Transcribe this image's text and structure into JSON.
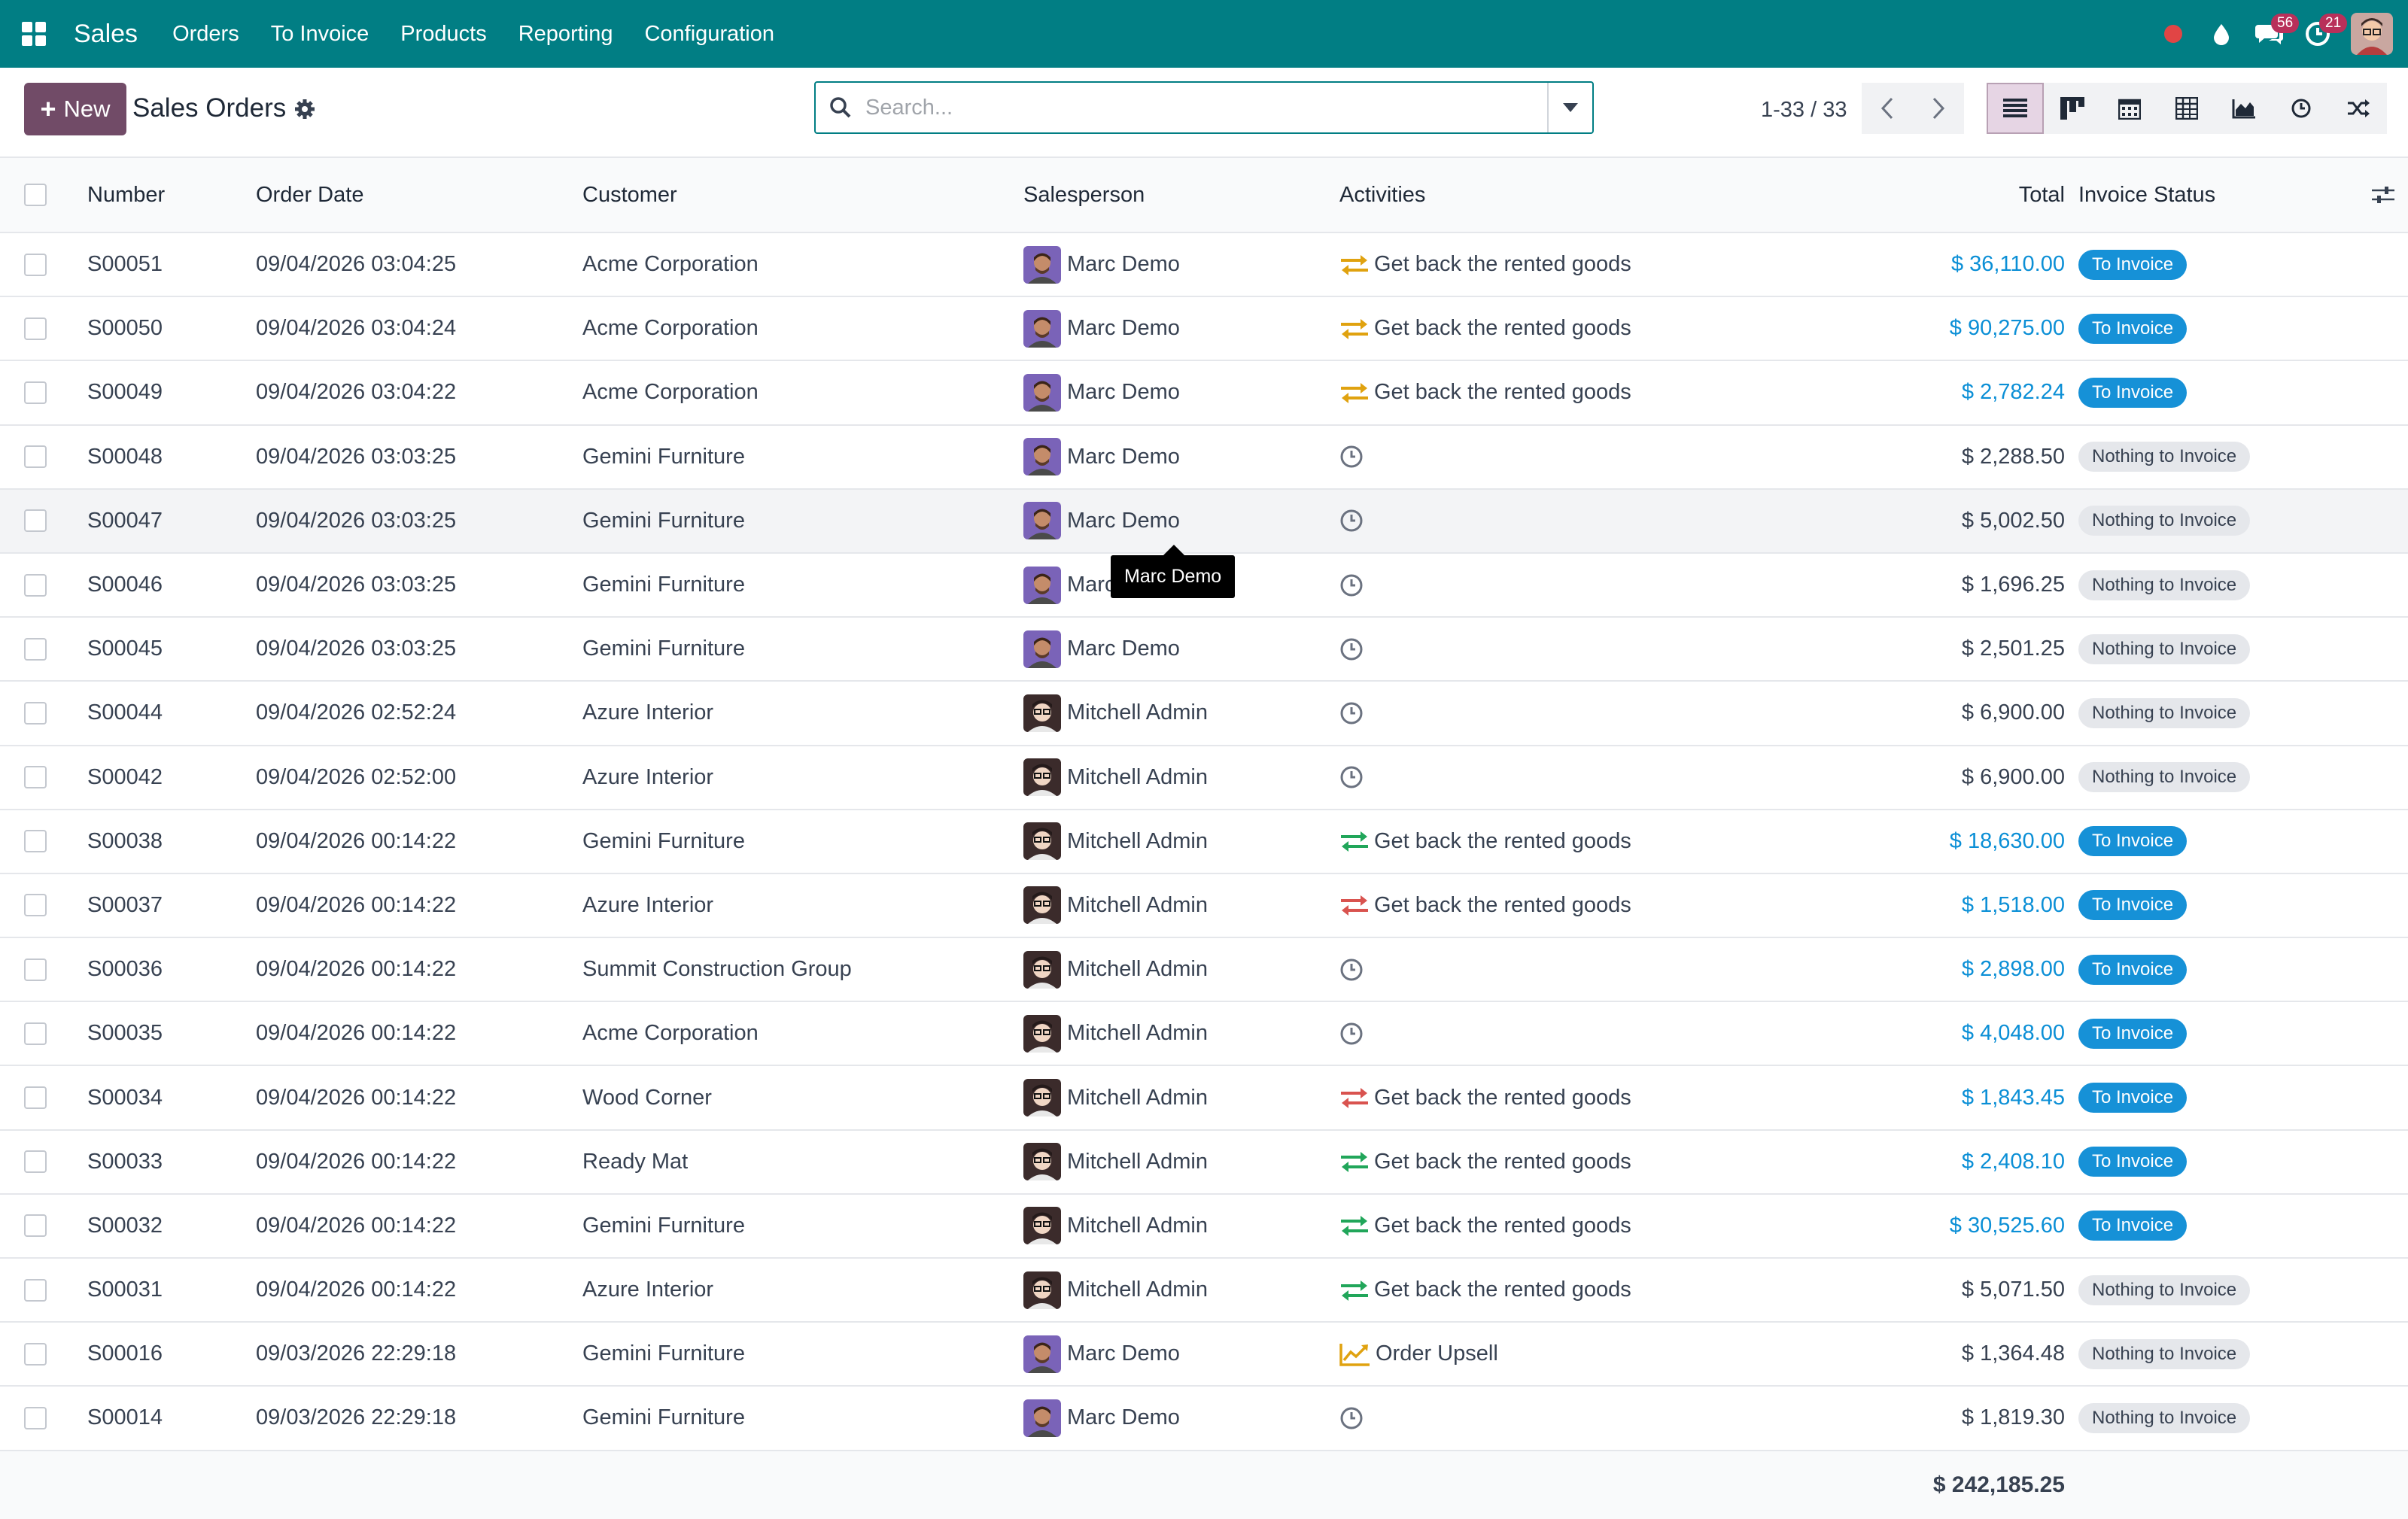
{
  "navbar": {
    "app_name": "Sales",
    "menu": [
      "Orders",
      "To Invoice",
      "Products",
      "Reporting",
      "Configuration"
    ],
    "messages_count": "56",
    "activities_count": "21",
    "colors": {
      "bar": "#017e84",
      "badge": "#b8305a"
    }
  },
  "control_panel": {
    "new_label": "New",
    "title": "Sales Orders",
    "search_placeholder": "Search...",
    "pager": "1-33 / 33",
    "views": [
      "list-view",
      "kanban-view",
      "calendar-view",
      "pivot-view",
      "graph-view",
      "activity-view",
      "cohort-view"
    ],
    "active_view": "list-view"
  },
  "table": {
    "headers": {
      "number": "Number",
      "order_date": "Order Date",
      "customer": "Customer",
      "salesperson": "Salesperson",
      "activities": "Activities",
      "total": "Total",
      "invoice_status": "Invoice Status"
    },
    "rows": [
      {
        "number": "S00051",
        "date": "09/04/2026 03:04:25",
        "customer": "Acme Corporation",
        "salesperson": "Marc Demo",
        "avatar": "marc",
        "activity_icon": "exchange-icon",
        "activity_color": "#e0a20f",
        "activity": "Get back the rented goods",
        "total": "$ 36,110.00",
        "total_link": true,
        "status": "To Invoice",
        "status_type": "blue"
      },
      {
        "number": "S00050",
        "date": "09/04/2026 03:04:24",
        "customer": "Acme Corporation",
        "salesperson": "Marc Demo",
        "avatar": "marc",
        "activity_icon": "exchange-icon",
        "activity_color": "#e0a20f",
        "activity": "Get back the rented goods",
        "total": "$ 90,275.00",
        "total_link": true,
        "status": "To Invoice",
        "status_type": "blue"
      },
      {
        "number": "S00049",
        "date": "09/04/2026 03:04:22",
        "customer": "Acme Corporation",
        "salesperson": "Marc Demo",
        "avatar": "marc",
        "activity_icon": "exchange-icon",
        "activity_color": "#e0a20f",
        "activity": "Get back the rented goods",
        "total": "$ 2,782.24",
        "total_link": true,
        "status": "To Invoice",
        "status_type": "blue"
      },
      {
        "number": "S00048",
        "date": "09/04/2026 03:03:25",
        "customer": "Gemini Furniture",
        "salesperson": "Marc Demo",
        "avatar": "marc",
        "activity_icon": "clock-icon",
        "activity_color": "#6b7280",
        "activity": "",
        "total": "$ 2,288.50",
        "total_link": false,
        "status": "Nothing to Invoice",
        "status_type": "grey"
      },
      {
        "number": "S00047",
        "date": "09/04/2026 03:03:25",
        "customer": "Gemini Furniture",
        "salesperson": "Marc Demo",
        "avatar": "marc",
        "activity_icon": "clock-icon",
        "activity_color": "#6b7280",
        "activity": "",
        "total": "$ 5,002.50",
        "total_link": false,
        "status": "Nothing to Invoice",
        "status_type": "grey",
        "hover": true
      },
      {
        "number": "S00046",
        "date": "09/04/2026 03:03:25",
        "customer": "Gemini Furniture",
        "salesperson": "Marc Demo",
        "avatar": "marc",
        "activity_icon": "clock-icon",
        "activity_color": "#6b7280",
        "activity": "",
        "total": "$ 1,696.25",
        "total_link": false,
        "status": "Nothing to Invoice",
        "status_type": "grey"
      },
      {
        "number": "S00045",
        "date": "09/04/2026 03:03:25",
        "customer": "Gemini Furniture",
        "salesperson": "Marc Demo",
        "avatar": "marc",
        "activity_icon": "clock-icon",
        "activity_color": "#6b7280",
        "activity": "",
        "total": "$ 2,501.25",
        "total_link": false,
        "status": "Nothing to Invoice",
        "status_type": "grey"
      },
      {
        "number": "S00044",
        "date": "09/04/2026 02:52:24",
        "customer": "Azure Interior",
        "salesperson": "Mitchell Admin",
        "avatar": "mitchell",
        "activity_icon": "clock-icon",
        "activity_color": "#6b7280",
        "activity": "",
        "total": "$ 6,900.00",
        "total_link": false,
        "status": "Nothing to Invoice",
        "status_type": "grey"
      },
      {
        "number": "S00042",
        "date": "09/04/2026 02:52:00",
        "customer": "Azure Interior",
        "salesperson": "Mitchell Admin",
        "avatar": "mitchell",
        "activity_icon": "clock-icon",
        "activity_color": "#6b7280",
        "activity": "",
        "total": "$ 6,900.00",
        "total_link": false,
        "status": "Nothing to Invoice",
        "status_type": "grey"
      },
      {
        "number": "S00038",
        "date": "09/04/2026 00:14:22",
        "customer": "Gemini Furniture",
        "salesperson": "Mitchell Admin",
        "avatar": "mitchell",
        "activity_icon": "exchange-icon",
        "activity_color": "#21a65a",
        "activity": "Get back the rented goods",
        "total": "$ 18,630.00",
        "total_link": true,
        "status": "To Invoice",
        "status_type": "blue"
      },
      {
        "number": "S00037",
        "date": "09/04/2026 00:14:22",
        "customer": "Azure Interior",
        "salesperson": "Mitchell Admin",
        "avatar": "mitchell",
        "activity_icon": "exchange-icon",
        "activity_color": "#d9534f",
        "activity": "Get back the rented goods",
        "total": "$ 1,518.00",
        "total_link": true,
        "status": "To Invoice",
        "status_type": "blue"
      },
      {
        "number": "S00036",
        "date": "09/04/2026 00:14:22",
        "customer": "Summit Construction Group",
        "salesperson": "Mitchell Admin",
        "avatar": "mitchell",
        "activity_icon": "clock-icon",
        "activity_color": "#6b7280",
        "activity": "",
        "total": "$ 2,898.00",
        "total_link": true,
        "status": "To Invoice",
        "status_type": "blue"
      },
      {
        "number": "S00035",
        "date": "09/04/2026 00:14:22",
        "customer": "Acme Corporation",
        "salesperson": "Mitchell Admin",
        "avatar": "mitchell",
        "activity_icon": "clock-icon",
        "activity_color": "#6b7280",
        "activity": "",
        "total": "$ 4,048.00",
        "total_link": true,
        "status": "To Invoice",
        "status_type": "blue"
      },
      {
        "number": "S00034",
        "date": "09/04/2026 00:14:22",
        "customer": "Wood Corner",
        "salesperson": "Mitchell Admin",
        "avatar": "mitchell",
        "activity_icon": "exchange-icon",
        "activity_color": "#d9534f",
        "activity": "Get back the rented goods",
        "total": "$ 1,843.45",
        "total_link": true,
        "status": "To Invoice",
        "status_type": "blue"
      },
      {
        "number": "S00033",
        "date": "09/04/2026 00:14:22",
        "customer": "Ready Mat",
        "salesperson": "Mitchell Admin",
        "avatar": "mitchell",
        "activity_icon": "exchange-icon",
        "activity_color": "#21a65a",
        "activity": "Get back the rented goods",
        "total": "$ 2,408.10",
        "total_link": true,
        "status": "To Invoice",
        "status_type": "blue"
      },
      {
        "number": "S00032",
        "date": "09/04/2026 00:14:22",
        "customer": "Gemini Furniture",
        "salesperson": "Mitchell Admin",
        "avatar": "mitchell",
        "activity_icon": "exchange-icon",
        "activity_color": "#21a65a",
        "activity": "Get back the rented goods",
        "total": "$ 30,525.60",
        "total_link": true,
        "status": "To Invoice",
        "status_type": "blue"
      },
      {
        "number": "S00031",
        "date": "09/04/2026 00:14:22",
        "customer": "Azure Interior",
        "salesperson": "Mitchell Admin",
        "avatar": "mitchell",
        "activity_icon": "exchange-icon",
        "activity_color": "#21a65a",
        "activity": "Get back the rented goods",
        "total": "$ 5,071.50",
        "total_link": false,
        "status": "Nothing to Invoice",
        "status_type": "grey"
      },
      {
        "number": "S00016",
        "date": "09/03/2026 22:29:18",
        "customer": "Gemini Furniture",
        "salesperson": "Marc Demo",
        "avatar": "marc",
        "activity_icon": "upsell-chart-icon",
        "activity_color": "#e0a20f",
        "activity": "Order Upsell",
        "total": "$ 1,364.48",
        "total_link": false,
        "status": "Nothing to Invoice",
        "status_type": "grey"
      },
      {
        "number": "S00014",
        "date": "09/03/2026 22:29:18",
        "customer": "Gemini Furniture",
        "salesperson": "Marc Demo",
        "avatar": "marc",
        "activity_icon": "clock-icon",
        "activity_color": "#6b7280",
        "activity": "",
        "total": "$ 1,819.30",
        "total_link": false,
        "status": "Nothing to Invoice",
        "status_type": "grey"
      }
    ],
    "footer_total": "$ 242,185.25"
  },
  "tooltip": {
    "text": "Marc Demo"
  }
}
